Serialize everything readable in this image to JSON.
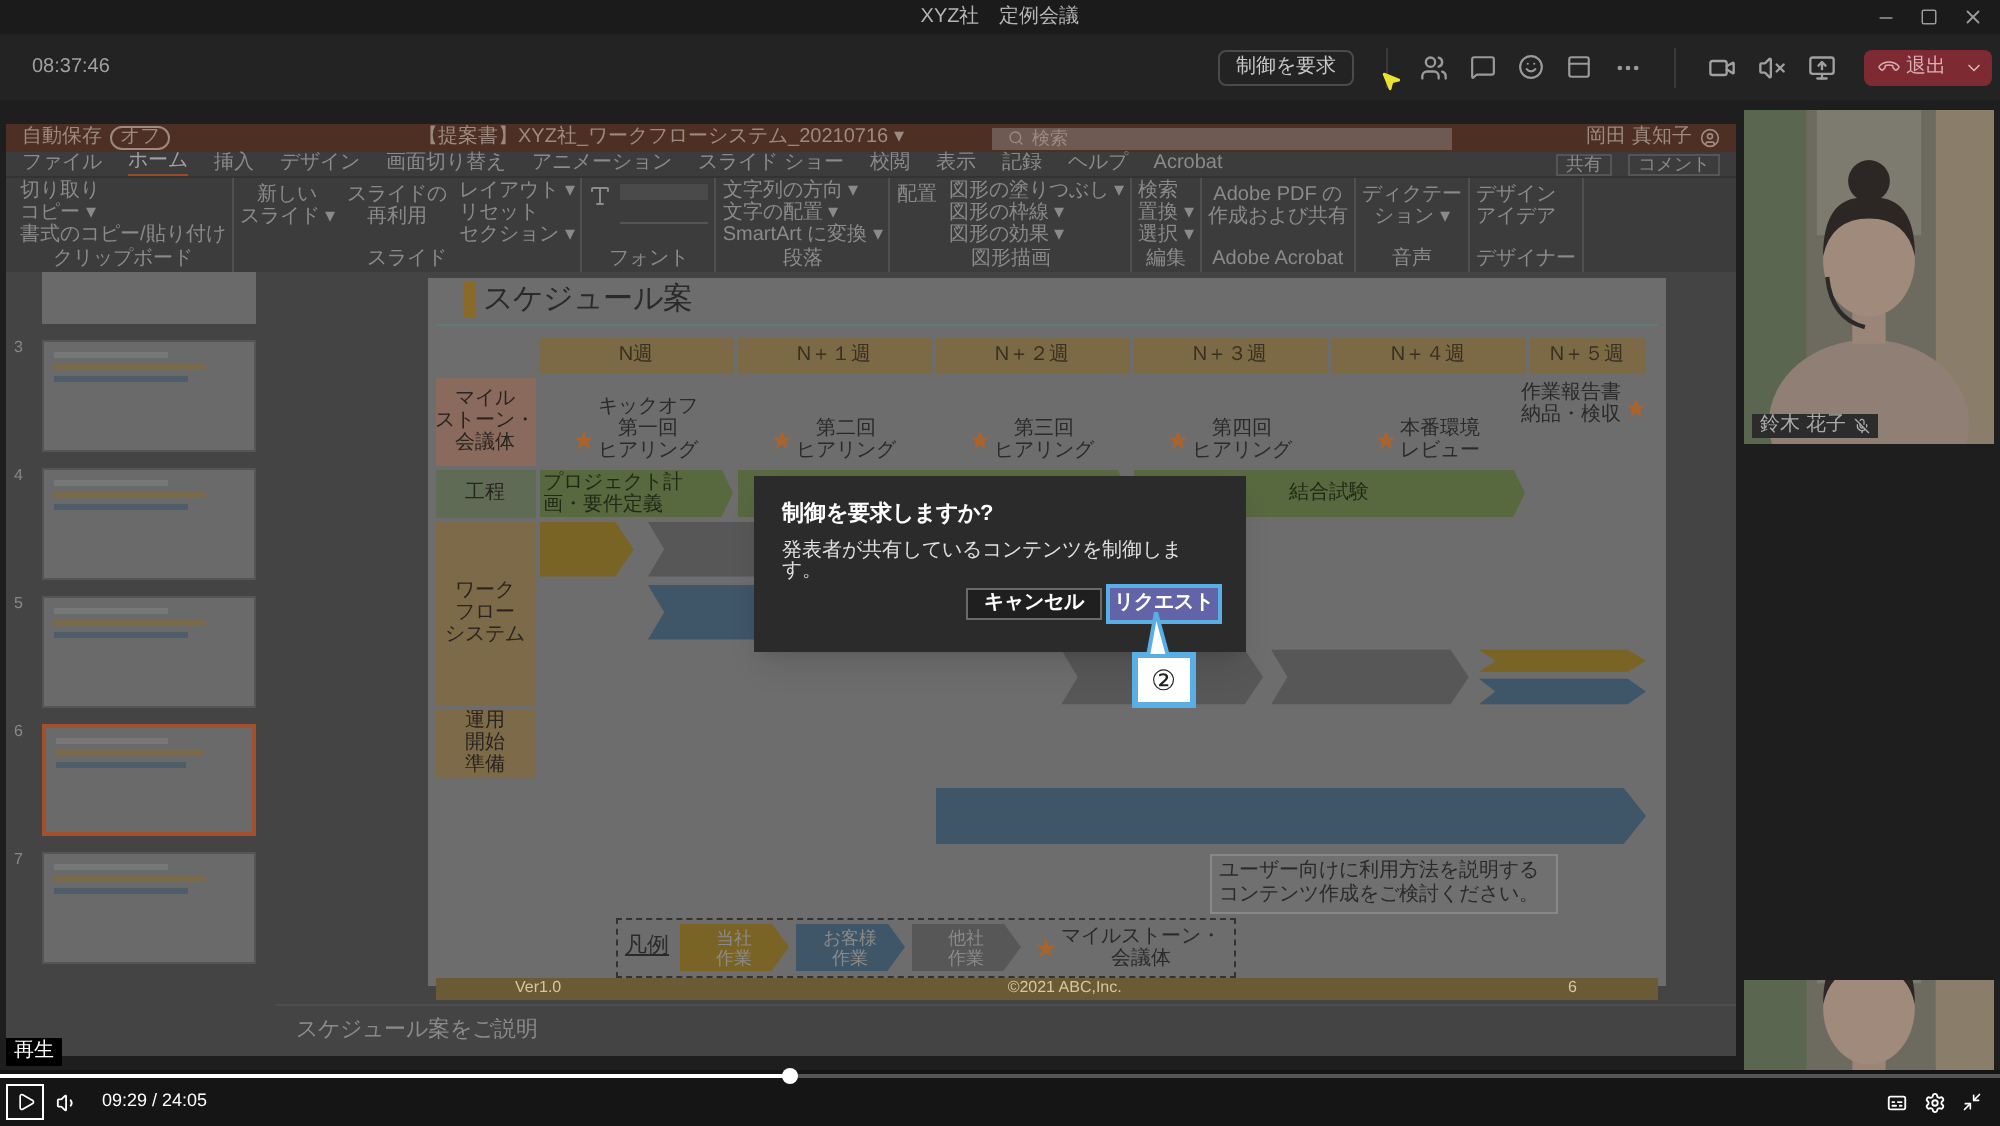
{
  "window": {
    "title": "XYZ社　定例会議"
  },
  "meeting_bar": {
    "time": "08:37:46",
    "request_control_button": "制御を要求",
    "leave_button": "退出"
  },
  "shared_screen": {
    "title_bar": {
      "autosave_label": "自動保存",
      "autosave_toggle": "オフ",
      "document_title": "【提案書】XYZ社_ワークフローシステム_20210716 ▾",
      "search_placeholder": "検索",
      "user_name": "岡田 真知子"
    },
    "ribbon_tabs": [
      {
        "label": "ファイル",
        "selected": false
      },
      {
        "label": "ホーム",
        "selected": true
      },
      {
        "label": "挿入",
        "selected": false
      },
      {
        "label": "デザイン",
        "selected": false
      },
      {
        "label": "画面切り替え",
        "selected": false
      },
      {
        "label": "アニメーション",
        "selected": false
      },
      {
        "label": "スライド ショー",
        "selected": false
      },
      {
        "label": "校閲",
        "selected": false
      },
      {
        "label": "表示",
        "selected": false
      },
      {
        "label": "記録",
        "selected": false
      },
      {
        "label": "ヘルプ",
        "selected": false
      },
      {
        "label": "Acrobat",
        "selected": false
      }
    ],
    "ribbon_actions": [
      "共有",
      "コメント"
    ],
    "ribbon_groups": [
      {
        "label": "クリップボード",
        "columns": [
          [
            "切り取り",
            "コピー ▾",
            "書式のコピー/貼り付け"
          ]
        ]
      },
      {
        "label": "スライド",
        "columns": [
          [
            [
              "新しい",
              "スライド ▾"
            ]
          ],
          [
            [
              "スライドの",
              "再利用"
            ]
          ],
          [
            "レイアウト ▾",
            "リセット",
            "セクション ▾"
          ]
        ]
      },
      {
        "label": "フォント"
      },
      {
        "label": "段落",
        "columns": [
          [
            "文字列の方向 ▾",
            "文字の配置 ▾",
            "SmartArt に変換 ▾"
          ]
        ]
      },
      {
        "label": "図形描画",
        "columns": [
          [
            [
              "配置"
            ]
          ],
          [
            "図形の塗りつぶし ▾",
            "図形の枠線 ▾",
            "図形の効果 ▾"
          ]
        ]
      },
      {
        "label": "編集",
        "columns": [
          [
            "検索",
            "置換 ▾",
            "選択 ▾"
          ]
        ]
      },
      {
        "label": "Adobe Acrobat",
        "columns": [
          [
            [
              "Adobe PDF の",
              "作成および共有"
            ]
          ]
        ]
      },
      {
        "label": "音声",
        "columns": [
          [
            [
              "ディクテー",
              "ション ▾"
            ]
          ]
        ]
      },
      {
        "label": "デザイナー",
        "columns": [
          [
            [
              "デザイン",
              "アイデア"
            ]
          ]
        ]
      }
    ],
    "thumbnails": [
      {
        "number": "3",
        "selected": false
      },
      {
        "number": "4",
        "selected": false
      },
      {
        "number": "5",
        "selected": false
      },
      {
        "number": "6",
        "selected": true
      },
      {
        "number": "7",
        "selected": false
      }
    ],
    "slide": {
      "title": "スケジュール案",
      "weeks": [
        "N週",
        "N＋１週",
        "N＋２週",
        "N＋３週",
        "N＋４週",
        "N＋５週"
      ],
      "row_labels": [
        {
          "lines": [
            "マイル",
            "ストーン・",
            "会議体"
          ],
          "color": "#8a6a5c"
        },
        {
          "lines": [
            "工程"
          ],
          "color": "#5f6b55"
        },
        {
          "lines": [
            "ワーク",
            "フロー",
            "システム"
          ],
          "color": "#7d6a48"
        },
        {
          "lines": [
            "運用",
            "開始",
            "準備"
          ],
          "color": "#7d6a48"
        }
      ],
      "milestones": [
        {
          "lines": [
            "キックオフ",
            "第一回",
            "ヒアリング"
          ]
        },
        {
          "lines": [
            "第二回",
            "ヒアリング"
          ]
        },
        {
          "lines": [
            "第三回",
            "ヒアリング"
          ]
        },
        {
          "lines": [
            "第四回",
            "ヒアリング"
          ]
        },
        {
          "lines": [
            "本番環境",
            "レビュー"
          ]
        },
        {
          "lines": [
            "作業報告書",
            "納品・検収"
          ]
        }
      ],
      "process_bars": [
        "プロジェクト計画・要件定義",
        "結合試験"
      ],
      "callout": [
        "ユーザー向けに利用方法を説明する",
        "コンテンツ作成をご検討ください。"
      ],
      "legend": {
        "title": "凡例",
        "items": [
          {
            "lines": [
              "当社",
              "作業"
            ],
            "color": "#7a6425"
          },
          {
            "lines": [
              "お客様",
              "作業"
            ],
            "color": "#3f5668"
          },
          {
            "lines": [
              "他社",
              "作業"
            ],
            "color": "#575757"
          }
        ],
        "milestone_label": [
          "マイルストーン・",
          "会議体"
        ]
      },
      "footer": {
        "version": "Ver1.0",
        "copyright": "©2021 ABC,Inc.",
        "page": "6"
      }
    },
    "notes": "スケジュール案をご説明"
  },
  "dialog": {
    "title": "制御を要求しますか?",
    "message": "発表者が共有しているコンテンツを制御します。",
    "cancel_button": "キャンセル",
    "request_button": "リクエスト",
    "step_callout": "②"
  },
  "video_tile": {
    "name": "鈴木 花子",
    "muted": true
  },
  "player": {
    "tooltip": "再生",
    "time": "09:29 / 24:05",
    "level": 0.395
  }
}
